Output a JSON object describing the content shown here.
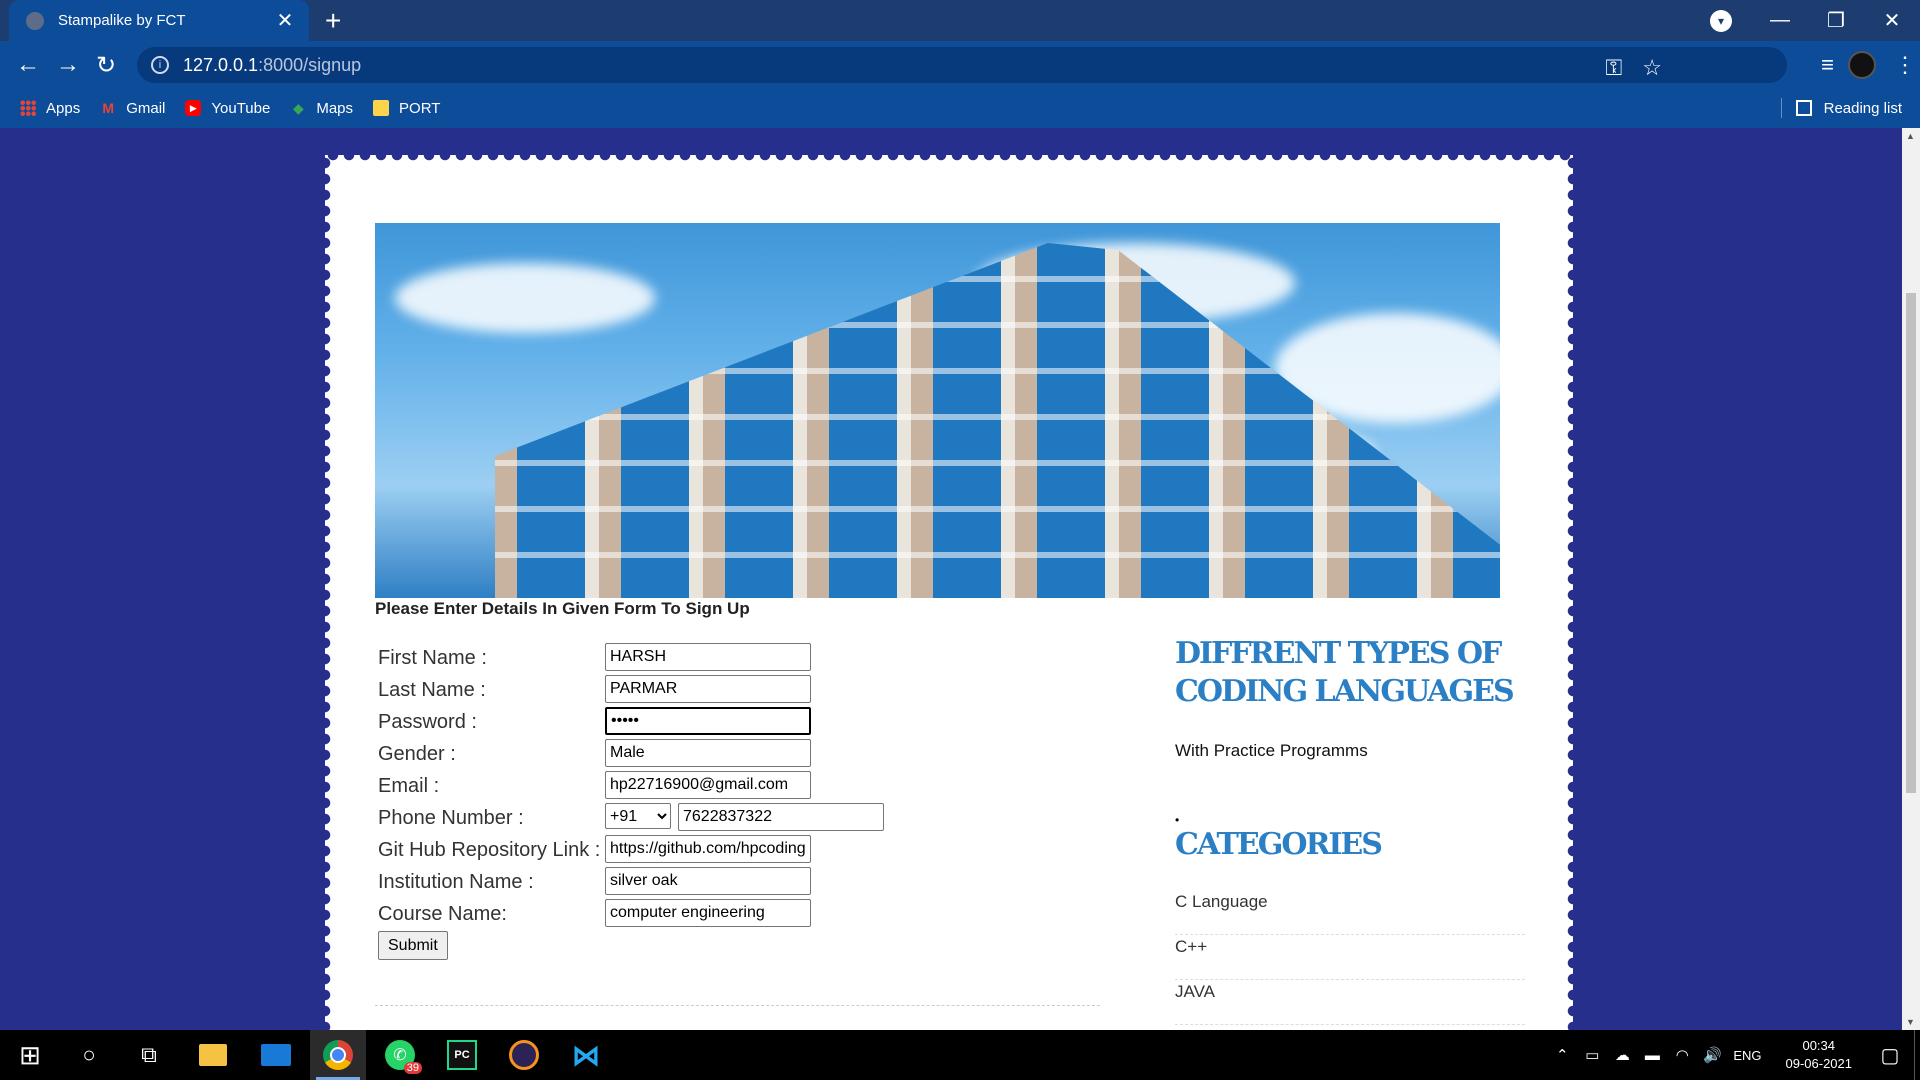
{
  "browser": {
    "tab_title": "Stampalike by FCT",
    "tab_close": "✕",
    "new_tab": "+",
    "url_host": "127.0.0.1",
    "url_path": ":8000/signup",
    "window_buttons": [
      "—",
      "❐",
      "✕"
    ],
    "bookmarks": [
      {
        "label": "Apps",
        "icon": "apps-grid-icon"
      },
      {
        "label": "Gmail",
        "icon": "gmail-icon"
      },
      {
        "label": "YouTube",
        "icon": "youtube-icon"
      },
      {
        "label": "Maps",
        "icon": "maps-icon"
      },
      {
        "label": "PORT",
        "icon": "folder-icon"
      }
    ],
    "reading_list": "Reading list"
  },
  "page": {
    "form_heading": "Please Enter Details In Given Form To Sign Up",
    "fields": {
      "first_name": {
        "label": "First Name :",
        "value": "HARSH"
      },
      "last_name": {
        "label": "Last Name :",
        "value": "PARMAR"
      },
      "password": {
        "label": "Password :",
        "value": "•••••"
      },
      "gender": {
        "label": "Gender :",
        "value": "Male"
      },
      "email": {
        "label": "Email :",
        "value": "hp22716900@gmail.com"
      },
      "phone": {
        "label": "Phone Number :",
        "country_code": "+91",
        "value": "7622837322"
      },
      "github": {
        "label": "Git Hub Repository Link :",
        "value": "https://github.com/hpcoding"
      },
      "institution": {
        "label": "Institution Name :",
        "value": "silver oak"
      },
      "course": {
        "label": "Course Name:",
        "value": "computer engineering"
      }
    },
    "submit_label": "Submit",
    "sidebar": {
      "title_line1": "DIFFRENT TYPES OF",
      "title_line2": "CODING LANGUAGES",
      "subtitle": "With Practice Programms",
      "bullet": "•",
      "categories_title": "CATEGORIES",
      "categories": [
        "C Language",
        "C++",
        "JAVA"
      ]
    }
  },
  "taskbar": {
    "whatsapp_badge": "39",
    "pycharm_label": "PC",
    "language": "ENG",
    "time": "00:34",
    "date": "09-06-2021"
  },
  "colors": {
    "page_background": "#272f8d",
    "browser_chrome": "#0d4c99",
    "sidebar_heading": "#2b7fc4"
  }
}
